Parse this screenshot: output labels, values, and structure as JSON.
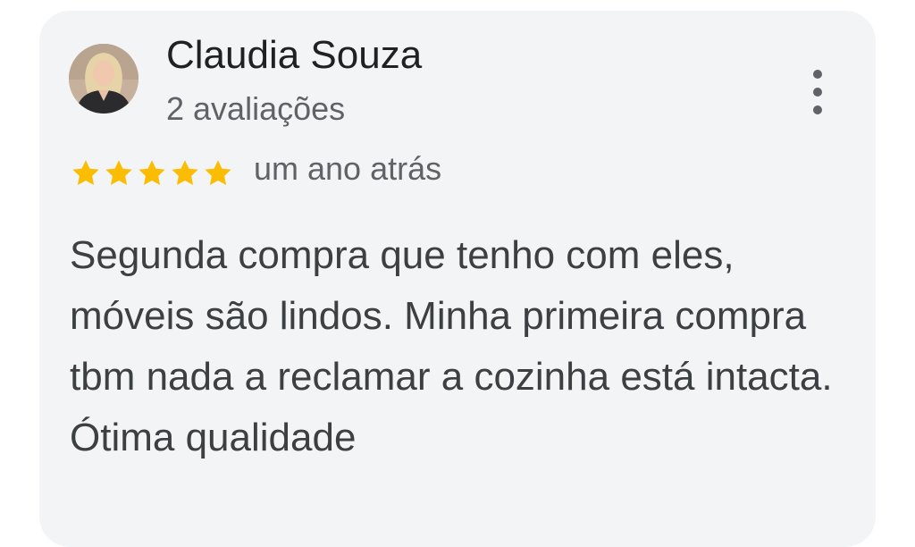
{
  "review": {
    "reviewer_name": "Claudia Souza",
    "review_count": "2 avaliações",
    "rating": 5,
    "rating_max": 5,
    "star_color": "#fbbc04",
    "time_ago": "um ano atrás",
    "text": "Segunda compra que tenho com eles, móveis são lindos. Minha primeira compra tbm nada a reclamar a cozinha está intacta. Ótima qualidade",
    "avatar": "profile-photo",
    "menu_icon": "more-vert-icon"
  }
}
